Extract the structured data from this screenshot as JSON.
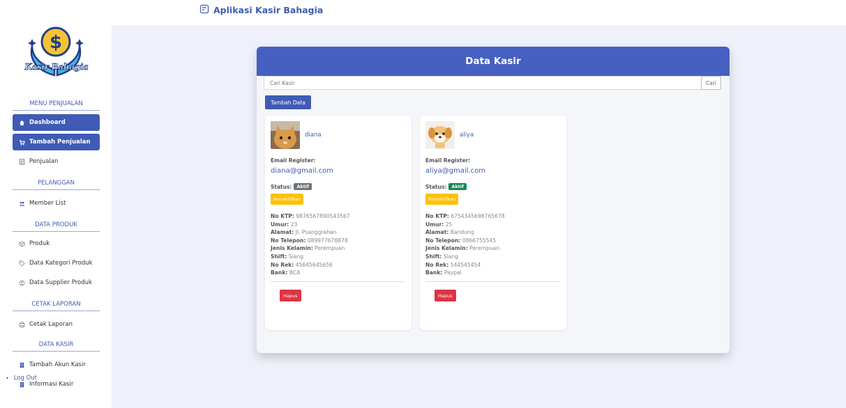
{
  "app": {
    "title": "Aplikasi Kasir Bahagia"
  },
  "logo": {
    "text": "Kasir Bahagia",
    "symbol": "$"
  },
  "sidebar": {
    "sections": [
      {
        "title": "MENU PENJUALAN"
      },
      {
        "title": "PELANGGAN"
      },
      {
        "title": "DATA PRODUK"
      },
      {
        "title": "CETAK LAPORAN"
      },
      {
        "title": "DATA KASIR"
      }
    ],
    "items": [
      {
        "label": "Dashboard",
        "icon": "home-icon",
        "active": true
      },
      {
        "label": "Tambah Penjualan",
        "icon": "cart-icon",
        "active": true
      },
      {
        "label": "Penjualan",
        "icon": "list-icon",
        "active": false
      },
      {
        "label": "Member List",
        "icon": "users-icon",
        "active": false
      },
      {
        "label": "Produk",
        "icon": "box-icon",
        "active": false
      },
      {
        "label": "Data Kategori Produk",
        "icon": "tag-icon",
        "active": false
      },
      {
        "label": "Data Supplier Produk",
        "icon": "supplier-icon",
        "active": false
      },
      {
        "label": "Cetak Laporan",
        "icon": "printer-icon",
        "active": false
      },
      {
        "label": "Tambah Akun Kasir",
        "icon": "account-add-icon",
        "active": false
      },
      {
        "label": "Informasi Kasir",
        "icon": "info-icon",
        "active": false
      }
    ],
    "logout": "Log Out"
  },
  "panel": {
    "title": "Data Kasir",
    "search_placeholder": "Cari Kasir",
    "search_button": "Cari",
    "add_button": "Tambah Data"
  },
  "kasir": [
    {
      "name": "diana",
      "email_label": "Email Register:",
      "email": "diana@gmail.com",
      "status_label": "Status:",
      "status": "Aktif",
      "toggle_button": "Nonaktifkan",
      "details": [
        {
          "label": "No KTP:",
          "value": "9876567890543567"
        },
        {
          "label": "Umur:",
          "value": "23"
        },
        {
          "label": "Alamat:",
          "value": "Jl. Psanggrahan"
        },
        {
          "label": "No Telepon:",
          "value": "089977678878"
        },
        {
          "label": "Jenis Kelamin:",
          "value": "Perempuan"
        },
        {
          "label": "Shift:",
          "value": "Siang"
        },
        {
          "label": "No Rek:",
          "value": "45645645656"
        },
        {
          "label": "Bank:",
          "value": "BCA"
        }
      ],
      "delete_button": "Hapus"
    },
    {
      "name": "aliya",
      "email_label": "Email Register:",
      "email": "aliya@gmail.com",
      "status_label": "Status:",
      "status": "Aktif",
      "toggle_button": "Nonaktifkan",
      "details": [
        {
          "label": "No KTP:",
          "value": "6754345698765678"
        },
        {
          "label": "Umur:",
          "value": "25"
        },
        {
          "label": "Alamat:",
          "value": "Bandung"
        },
        {
          "label": "No Telepon:",
          "value": "0866755545"
        },
        {
          "label": "Jenis Kelamin:",
          "value": "Perempuan"
        },
        {
          "label": "Shift:",
          "value": "Siang"
        },
        {
          "label": "No Rek:",
          "value": "544545454"
        },
        {
          "label": "Bank:",
          "value": "Paypal"
        }
      ],
      "delete_button": "Hapus"
    }
  ],
  "colors": {
    "primary": "#3f5bb5",
    "header": "#4560c0",
    "warning": "#ffc107",
    "danger": "#dc3545",
    "success": "#198754",
    "secondary": "#6c757d"
  }
}
